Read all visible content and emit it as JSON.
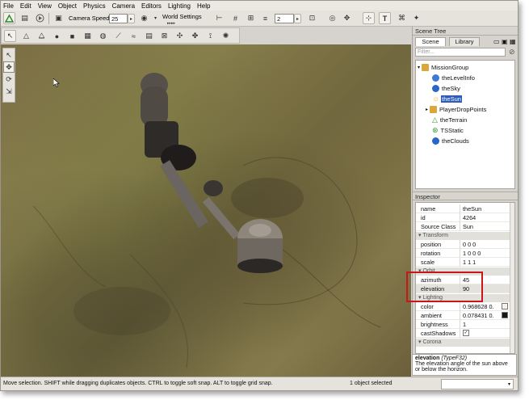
{
  "menu": [
    "File",
    "Edit",
    "View",
    "Object",
    "Physics",
    "Camera",
    "Editors",
    "Lighting",
    "Help"
  ],
  "toolbar": {
    "camera_speed_label": "Camera Speed",
    "camera_speed_value": "25",
    "world_settings_label": "World Settings",
    "grid_value": "2"
  },
  "scene_tree": {
    "header": "Scene Tree",
    "tabs": [
      "Scene",
      "Library"
    ],
    "filter_placeholder": "Filter...",
    "items": [
      {
        "label": "MissionGroup",
        "icon": "folder-icon",
        "color": "#d9a73a"
      },
      {
        "label": "theLevelInfo",
        "icon": "levelinfo-icon",
        "color": "#3b7bd4"
      },
      {
        "label": "theSky",
        "icon": "sky-icon",
        "color": "#2a66c7"
      },
      {
        "label": "theSun",
        "icon": "sun-icon",
        "color": "#f1b51c",
        "selected": true
      },
      {
        "label": "PlayerDropPoints",
        "icon": "folder-icon",
        "color": "#d9a73a"
      },
      {
        "label": "theTerrain",
        "icon": "terrain-icon",
        "color": "#3a9a3a"
      },
      {
        "label": "TSStatic",
        "icon": "static-icon",
        "color": "#2f8f2f"
      },
      {
        "label": "theClouds",
        "icon": "clouds-icon",
        "color": "#2a66c7"
      }
    ]
  },
  "inspector": {
    "header": "Inspector",
    "rows_top": [
      {
        "key": "name",
        "value": "theSun"
      },
      {
        "key": "id",
        "value": "4264"
      },
      {
        "key": "Source Class",
        "value": "Sun"
      }
    ],
    "group_transform": "Transform",
    "rows_transform": [
      {
        "key": "position",
        "value": "0 0 0"
      },
      {
        "key": "rotation",
        "value": "1 0 0 0"
      },
      {
        "key": "scale",
        "value": "1 1 1"
      }
    ],
    "group_orbit": "Orbit",
    "rows_orbit": [
      {
        "key": "azimuth",
        "value": "45"
      },
      {
        "key": "elevation",
        "value": "90"
      }
    ],
    "group_lighting": "Lighting",
    "rows_lighting": [
      {
        "key": "color",
        "value": "0.968628 0."
      },
      {
        "key": "ambient",
        "value": "0.078431 0."
      },
      {
        "key": "brightness",
        "value": "1"
      },
      {
        "key": "castShadows",
        "value": "✓"
      }
    ],
    "group_corona": "Corona"
  },
  "help": {
    "field_name": "elevation",
    "field_type": "(TypeF32)",
    "description": "The elevation angle of the sun above or below the horizon."
  },
  "status": {
    "message": "Move selection.  SHIFT while dragging duplicates objects.  CTRL to toggle soft snap.  ALT to toggle grid snap.",
    "selection": "1 object selected"
  }
}
